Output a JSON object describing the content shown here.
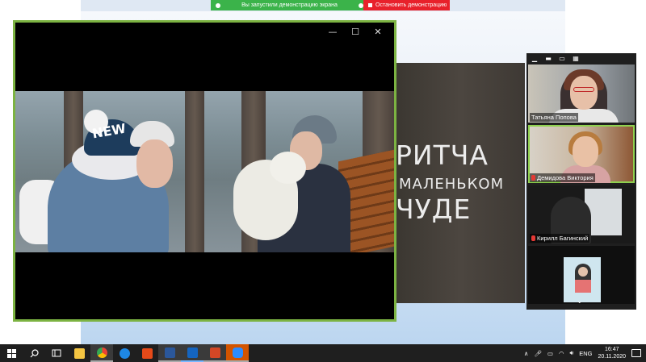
{
  "share_bar": {
    "status_text": "Вы запустили демонстрацию экрана",
    "stop_text": "Остановить демонстрацию",
    "colors": {
      "status": "#3bb34a",
      "stop": "#e8212b"
    }
  },
  "slide": {
    "lines": [
      "РИТЧА",
      "МАЛЕНЬКОМ",
      "ЧУДЕ"
    ]
  },
  "player": {
    "window_controls": {
      "minimize": "—",
      "maximize": "☐",
      "close": "✕"
    },
    "border_color": "#7cb342",
    "hat_text": "NEW"
  },
  "participants": {
    "toolbar_icons": [
      "minimize-icon",
      "speaker-view-icon",
      "gallery-strip-icon",
      "gallery-grid-icon"
    ],
    "items": [
      {
        "name": "Татьяна Попова",
        "muted": false
      },
      {
        "name": "Демидова Виктория",
        "muted": true
      },
      {
        "name": "Кирилл Багинский",
        "muted": true
      },
      {
        "name": "",
        "muted": false
      }
    ],
    "active_speaker_color": "#8fd14f",
    "scroll_glyph": "⌄"
  },
  "taskbar": {
    "apps": [
      "start",
      "search",
      "task-view",
      "file-explorer",
      "chrome",
      "edge",
      "office",
      "word",
      "video-player",
      "powerpoint",
      "zoom"
    ],
    "language": "ENG",
    "time": "16:47",
    "date": "20.11.2020"
  }
}
